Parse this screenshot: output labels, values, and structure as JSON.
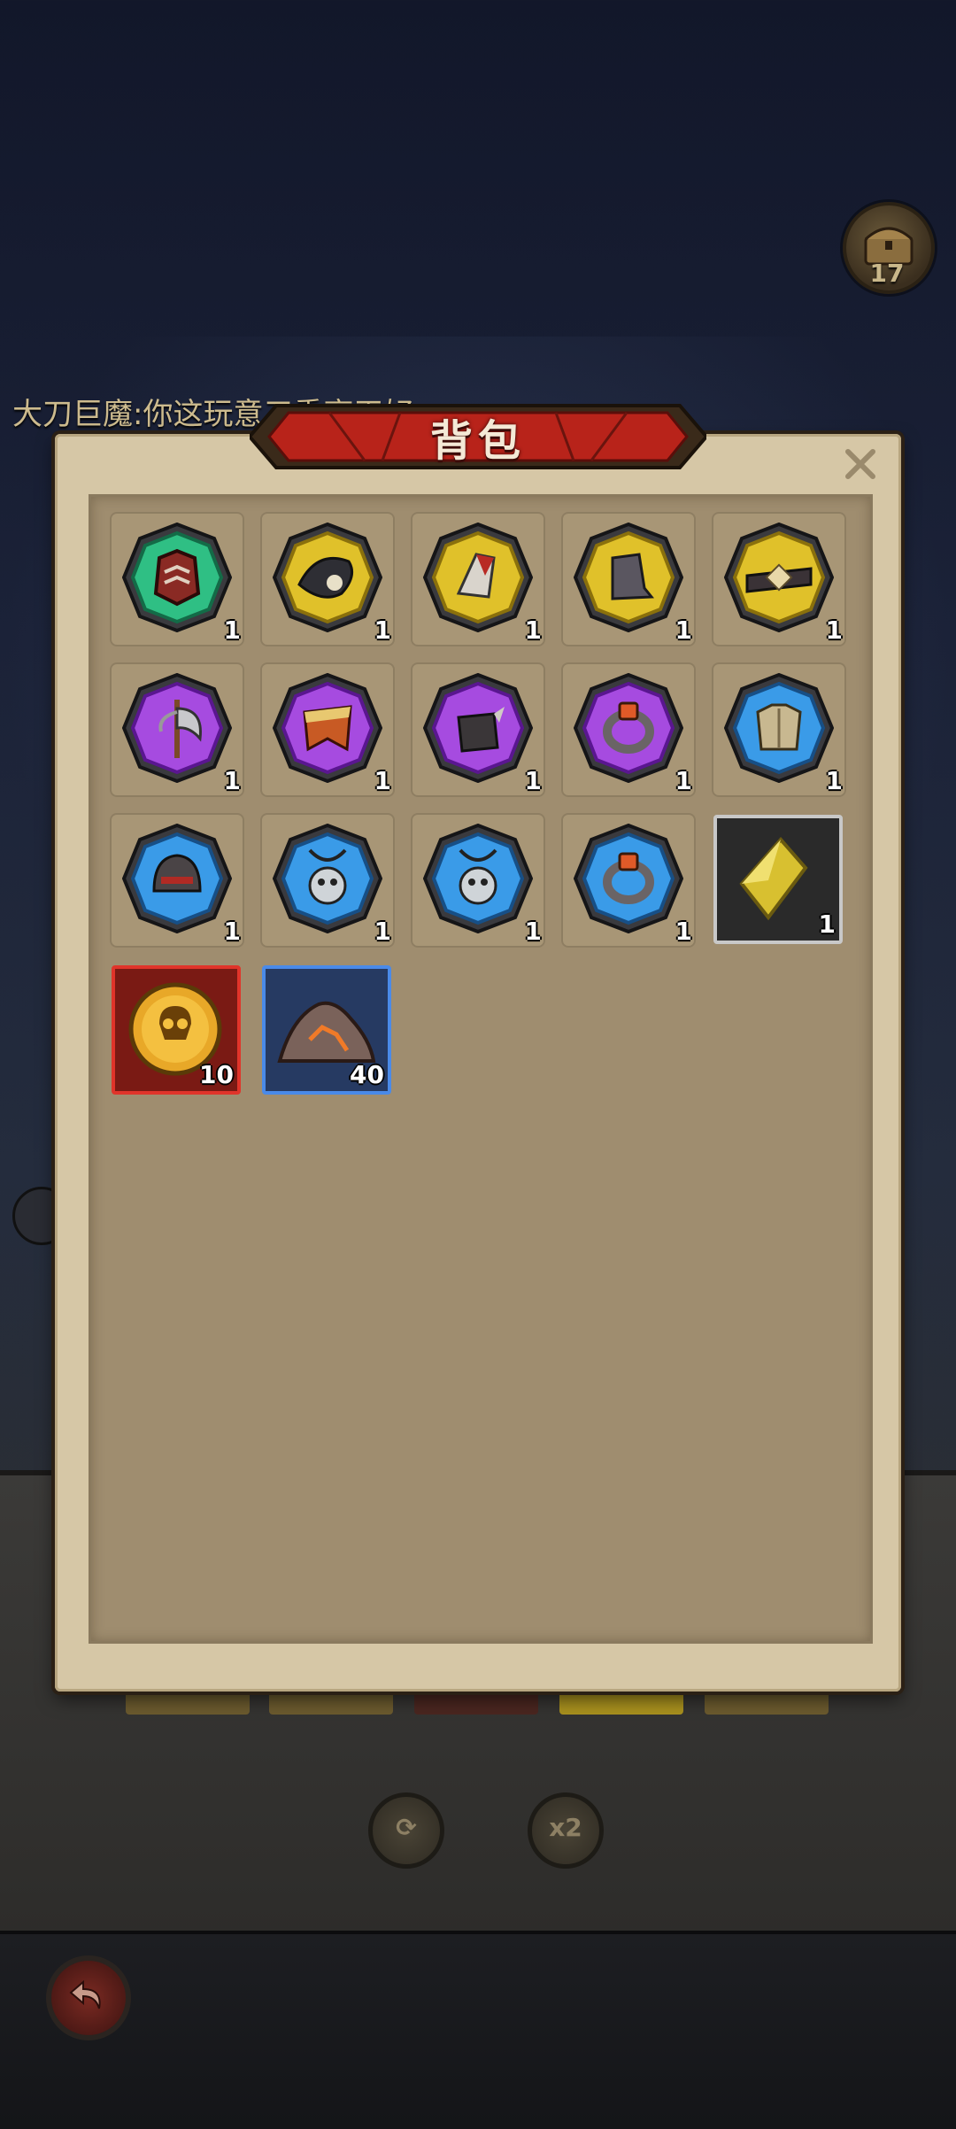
{
  "panel": {
    "title": "背包",
    "close_glyph": "✕"
  },
  "background": {
    "chat_text": "大刀巨魔:你这玩意三重亮天好",
    "chest_count": "17",
    "speed_label": "x2"
  },
  "colors": {
    "green": "#1f9a6a",
    "yellow": "#c8a61a",
    "purple": "#8a2bc4",
    "blue": "#1f78c4",
    "gray": "#2a2a2a"
  },
  "inventory": [
    {
      "name": "armor-chest-item",
      "rarity": "green",
      "icon": "armor-icon",
      "qty": "1"
    },
    {
      "name": "crow-helm-item",
      "rarity": "yellow",
      "icon": "crow-icon",
      "qty": "1"
    },
    {
      "name": "glove-item",
      "rarity": "yellow",
      "icon": "glove-icon",
      "qty": "1"
    },
    {
      "name": "boot-item",
      "rarity": "yellow",
      "icon": "boot-icon",
      "qty": "1"
    },
    {
      "name": "belt-item",
      "rarity": "yellow",
      "icon": "belt-icon",
      "qty": "1"
    },
    {
      "name": "axe-item",
      "rarity": "purple",
      "icon": "axe-icon",
      "qty": "1"
    },
    {
      "name": "cape-item",
      "rarity": "purple",
      "icon": "cape-icon",
      "qty": "1"
    },
    {
      "name": "gauntlet-item",
      "rarity": "purple",
      "icon": "gauntlet-icon",
      "qty": "1"
    },
    {
      "name": "ring-item",
      "rarity": "purple",
      "icon": "ring-icon",
      "qty": "1"
    },
    {
      "name": "shirt-item",
      "rarity": "blue",
      "icon": "shirt-icon",
      "qty": "1"
    },
    {
      "name": "helmet-item",
      "rarity": "blue",
      "icon": "helmet-icon",
      "qty": "1"
    },
    {
      "name": "skull-amulet-item",
      "rarity": "blue",
      "icon": "amulet-icon",
      "qty": "1"
    },
    {
      "name": "skull-amulet-item",
      "rarity": "blue",
      "icon": "amulet-icon",
      "qty": "1"
    },
    {
      "name": "ring-item",
      "rarity": "blue",
      "icon": "ring-icon",
      "qty": "1"
    },
    {
      "name": "yellow-crystal-item",
      "rarity": "gray",
      "icon": "crystal-icon",
      "qty": "1"
    },
    {
      "name": "skull-coin-item",
      "rarity": "red",
      "icon": "skull-coin-icon",
      "qty": "10"
    },
    {
      "name": "lava-ore-item",
      "rarity": "navy",
      "icon": "ore-icon",
      "qty": "40"
    }
  ]
}
